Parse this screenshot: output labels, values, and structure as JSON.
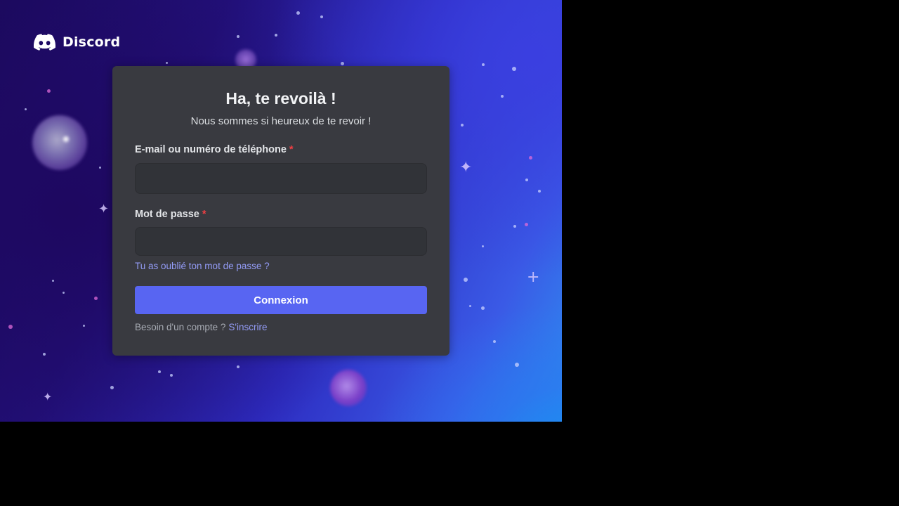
{
  "brand": {
    "name": "Discord"
  },
  "login": {
    "title": "Ha, te revoilà !",
    "subtitle": "Nous sommes si heureux de te revoir !",
    "email_label": "E-mail ou numéro de téléphone",
    "email_value": "",
    "password_label": "Mot de passe",
    "password_value": "",
    "required_marker": "*",
    "forgot_password_link": "Tu as oublié ton mot de passe ?",
    "submit_label": "Connexion",
    "register_prompt": "Besoin d'un compte ?",
    "register_link": "S'inscrire"
  },
  "colors": {
    "accent": "#5865f2",
    "card_background": "#393a40",
    "input_background": "#313338",
    "link": "#949cf7",
    "required": "#f23f43"
  },
  "icons": {
    "logo": "discord-logo-icon"
  }
}
